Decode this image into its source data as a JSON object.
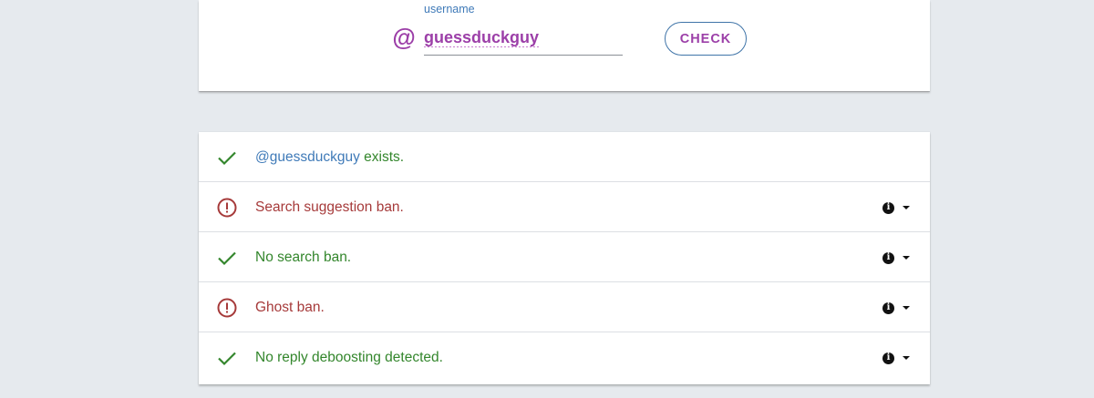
{
  "search": {
    "at_symbol": "@",
    "label": "username",
    "value": "guessduckguy",
    "button_label": "CHECK"
  },
  "results": [
    {
      "status": "ok",
      "prefix": "@guessduckguy",
      "text": " exists.",
      "has_info": false
    },
    {
      "status": "bad",
      "prefix": "",
      "text": "Search suggestion ban.",
      "has_info": true
    },
    {
      "status": "ok",
      "prefix": "",
      "text": "No search ban.",
      "has_info": true
    },
    {
      "status": "bad",
      "prefix": "",
      "text": "Ghost ban.",
      "has_info": true
    },
    {
      "status": "ok",
      "prefix": "",
      "text": "No reply deboosting detected.",
      "has_info": true
    }
  ],
  "icons": {
    "ok": "check-icon",
    "bad": "alert-circle-icon",
    "info": "info-icon",
    "toggle": "caret-down-icon"
  },
  "colors": {
    "ok": "#33862c",
    "bad": "#a63a3a",
    "accent": "#9c3fa8",
    "link": "#3f7ab8"
  }
}
